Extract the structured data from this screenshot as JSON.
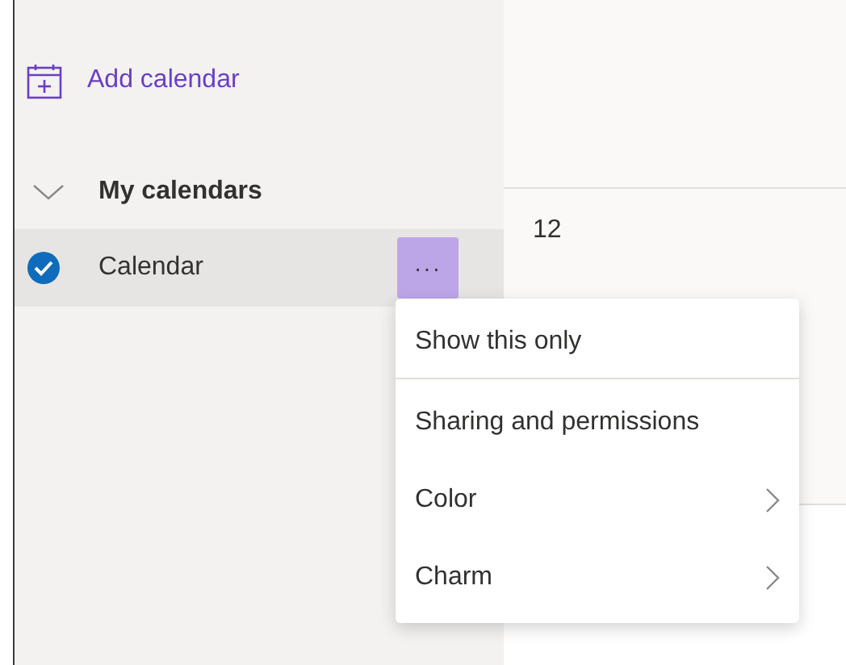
{
  "sidebar": {
    "add_calendar": {
      "label": "Add calendar"
    },
    "group": {
      "label": "My calendars",
      "expanded": true
    },
    "calendars": [
      {
        "name": "Calendar",
        "checked": true,
        "selected": true,
        "color": "#0f6cbd",
        "more_button": {
          "label": "···",
          "active": true
        }
      }
    ]
  },
  "calendar_grid": {
    "day_number": "12"
  },
  "context_menu": {
    "items": [
      {
        "label": "Show this only",
        "kind": "action",
        "divider_after": true
      },
      {
        "label": "Sharing and permissions",
        "kind": "action",
        "divider_after": false
      },
      {
        "label": "Color",
        "kind": "submenu",
        "divider_after": false
      },
      {
        "label": "Charm",
        "kind": "submenu",
        "divider_after": false
      }
    ]
  }
}
